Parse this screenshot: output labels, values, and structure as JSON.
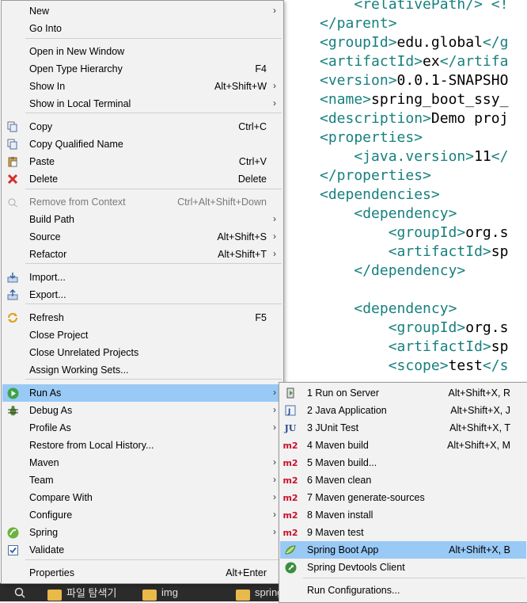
{
  "editor": {
    "lines": [
      {
        "indent": "    ",
        "tag": "<relativePath/> <!",
        "text": ""
      },
      {
        "indent": "",
        "tag": "</parent>",
        "text": ""
      },
      {
        "indent": "",
        "tag": "<groupId>",
        "text": "edu.global",
        "tag2": "</g"
      },
      {
        "indent": "",
        "tag": "<artifactId>",
        "text": "ex",
        "tag2": "</artifa"
      },
      {
        "indent": "",
        "tag": "<version>",
        "text": "0.0.1-SNAPSHO"
      },
      {
        "indent": "",
        "tag": "<name>",
        "text": "spring_boot_ssy_"
      },
      {
        "indent": "",
        "tag": "<description>",
        "text": "Demo proj"
      },
      {
        "indent": "",
        "tag": "<properties>",
        "text": ""
      },
      {
        "indent": "    ",
        "tag": "<java.version>",
        "text": "11",
        "tag2": "</"
      },
      {
        "indent": "",
        "tag": "</properties>",
        "text": ""
      },
      {
        "indent": "",
        "tag": "<dependencies>",
        "text": ""
      },
      {
        "indent": "    ",
        "tag": "<dependency>",
        "text": ""
      },
      {
        "indent": "        ",
        "tag": "<groupId>",
        "text": "org.s"
      },
      {
        "indent": "        ",
        "tag": "<artifactId>",
        "text": "sp"
      },
      {
        "indent": "    ",
        "tag": "</dependency>",
        "text": ""
      },
      {
        "indent": "",
        "tag": "",
        "text": ""
      },
      {
        "indent": "    ",
        "tag": "<dependency>",
        "text": ""
      },
      {
        "indent": "        ",
        "tag": "<groupId>",
        "text": "org.s"
      },
      {
        "indent": "        ",
        "tag": "<artifactId>",
        "text": "sp"
      },
      {
        "indent": "        ",
        "tag": "<scope>",
        "text": "test",
        "tag2": "</s"
      }
    ]
  },
  "main_menu": {
    "items": [
      {
        "label": "New",
        "shortcut": "",
        "arrow": true,
        "icon": ""
      },
      {
        "label": "Go Into",
        "shortcut": "",
        "arrow": false,
        "icon": ""
      },
      {
        "label": "Open in New Window",
        "shortcut": "",
        "arrow": false,
        "icon": ""
      },
      {
        "label": "Open Type Hierarchy",
        "shortcut": "F4",
        "arrow": false,
        "icon": ""
      },
      {
        "label": "Show In",
        "shortcut": "Alt+Shift+W",
        "arrow": true,
        "icon": ""
      },
      {
        "label": "Show in Local Terminal",
        "shortcut": "",
        "arrow": true,
        "icon": ""
      },
      {
        "label": "Copy",
        "shortcut": "Ctrl+C",
        "arrow": false,
        "icon": "copy-icon"
      },
      {
        "label": "Copy Qualified Name",
        "shortcut": "",
        "arrow": false,
        "icon": "copy-qualified-icon"
      },
      {
        "label": "Paste",
        "shortcut": "Ctrl+V",
        "arrow": false,
        "icon": "paste-icon"
      },
      {
        "label": "Delete",
        "shortcut": "Delete",
        "arrow": false,
        "icon": "delete-icon"
      },
      {
        "label": "Remove from Context",
        "shortcut": "Ctrl+Alt+Shift+Down",
        "arrow": false,
        "icon": "remove-context-icon",
        "disabled": true
      },
      {
        "label": "Build Path",
        "shortcut": "",
        "arrow": true,
        "icon": ""
      },
      {
        "label": "Source",
        "shortcut": "Alt+Shift+S",
        "arrow": true,
        "icon": ""
      },
      {
        "label": "Refactor",
        "shortcut": "Alt+Shift+T",
        "arrow": true,
        "icon": ""
      },
      {
        "label": "Import...",
        "shortcut": "",
        "arrow": false,
        "icon": "import-icon"
      },
      {
        "label": "Export...",
        "shortcut": "",
        "arrow": false,
        "icon": "export-icon"
      },
      {
        "label": "Refresh",
        "shortcut": "F5",
        "arrow": false,
        "icon": "refresh-icon"
      },
      {
        "label": "Close Project",
        "shortcut": "",
        "arrow": false,
        "icon": ""
      },
      {
        "label": "Close Unrelated Projects",
        "shortcut": "",
        "arrow": false,
        "icon": ""
      },
      {
        "label": "Assign Working Sets...",
        "shortcut": "",
        "arrow": false,
        "icon": ""
      },
      {
        "label": "Run As",
        "shortcut": "",
        "arrow": true,
        "icon": "run-icon",
        "selected": true
      },
      {
        "label": "Debug As",
        "shortcut": "",
        "arrow": true,
        "icon": "debug-icon"
      },
      {
        "label": "Profile As",
        "shortcut": "",
        "arrow": true,
        "icon": ""
      },
      {
        "label": "Restore from Local History...",
        "shortcut": "",
        "arrow": false,
        "icon": ""
      },
      {
        "label": "Maven",
        "shortcut": "",
        "arrow": true,
        "icon": ""
      },
      {
        "label": "Team",
        "shortcut": "",
        "arrow": true,
        "icon": ""
      },
      {
        "label": "Compare With",
        "shortcut": "",
        "arrow": true,
        "icon": ""
      },
      {
        "label": "Configure",
        "shortcut": "",
        "arrow": true,
        "icon": ""
      },
      {
        "label": "Spring",
        "shortcut": "",
        "arrow": true,
        "icon": "spring-icon"
      },
      {
        "label": "Validate",
        "shortcut": "",
        "arrow": false,
        "icon": "checkbox-icon"
      },
      {
        "label": "Properties",
        "shortcut": "Alt+Enter",
        "arrow": false,
        "icon": ""
      }
    ]
  },
  "run_as_menu": {
    "items": [
      {
        "label": "1 Run on Server",
        "shortcut": "Alt+Shift+X, R",
        "icon": "server-icon"
      },
      {
        "label": "2 Java Application",
        "shortcut": "Alt+Shift+X, J",
        "icon": "java-app-icon"
      },
      {
        "label": "3 JUnit Test",
        "shortcut": "Alt+Shift+X, T",
        "icon": "junit-icon",
        "icon_text": "JU"
      },
      {
        "label": "4 Maven build",
        "shortcut": "Alt+Shift+X, M",
        "icon": "maven-icon",
        "icon_text": "m2"
      },
      {
        "label": "5 Maven build...",
        "shortcut": "",
        "icon": "maven-icon",
        "icon_text": "m2"
      },
      {
        "label": "6 Maven clean",
        "shortcut": "",
        "icon": "maven-icon",
        "icon_text": "m2"
      },
      {
        "label": "7 Maven generate-sources",
        "shortcut": "",
        "icon": "maven-icon",
        "icon_text": "m2"
      },
      {
        "label": "8 Maven install",
        "shortcut": "",
        "icon": "maven-icon",
        "icon_text": "m2"
      },
      {
        "label": "9 Maven test",
        "shortcut": "",
        "icon": "maven-icon",
        "icon_text": "m2"
      },
      {
        "label": "Spring Boot App",
        "shortcut": "Alt+Shift+X, B",
        "icon": "spring-boot-icon",
        "selected": true
      },
      {
        "label": "Spring Devtools Client",
        "shortcut": "",
        "icon": "spring-devtools-icon"
      },
      {
        "label": "Run Configurations...",
        "shortcut": "",
        "icon": ""
      }
    ]
  },
  "taskbar": {
    "items": [
      {
        "label": "파일 탐색기",
        "icon": "folder-icon"
      },
      {
        "label": "img",
        "icon": "folder-icon"
      },
      {
        "label": "spring",
        "icon": "folder-icon"
      }
    ]
  }
}
